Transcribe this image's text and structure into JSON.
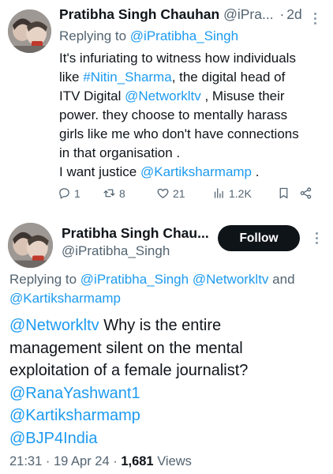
{
  "tweet1": {
    "author_name": "Pratibha Singh Chauhan",
    "author_handle_truncated": "@iPra...",
    "separator": "·",
    "time_ago": "2d",
    "replying_to_prefix": "Replying to",
    "replying_to_handle": "@iPratibha_Singh",
    "body": {
      "l1": "It's infuriating to witness how individuals",
      "l2_pre": "like ",
      "l2_tag": "#Nitin_Sharma",
      "l2_post": ", the digital head of",
      "l3_pre": "ITV Digital ",
      "l3_mention": "@Networkltv",
      "l3_post": " , Misuse their",
      "l4": "power. they choose to mentally harass",
      "l5": "girls like me who don't have connections",
      "l6": "in that organisation .",
      "l7_pre": "I want justice ",
      "l7_mention": "@Kartiksharmamp",
      "l7_post": " ."
    },
    "actions": {
      "replies": "1",
      "reposts": "8",
      "likes": "21",
      "views": "1.2K"
    }
  },
  "tweet2": {
    "author_name": "Pratibha Singh Chau...",
    "author_handle": "@iPratibha_Singh",
    "follow_label": "Follow",
    "replying_to_prefix": "Replying to",
    "replying_to_1": "@iPratibha_Singh",
    "replying_to_2": "@Networkltv",
    "replying_to_and": "and",
    "replying_to_3": "@Kartiksharmamp",
    "body": {
      "l1_mention": "@Networkltv",
      "l1_post": " Why is the entire",
      "l2": "management silent on the mental",
      "l3": "exploitation of a female journalist?",
      "l4": "@RanaYashwant1",
      "l5": "@Kartiksharmamp",
      "l6": "@BJP4India"
    },
    "meta": {
      "time": "21:31",
      "date": "19 Apr 24",
      "views_count": "1,681",
      "views_label": "Views",
      "sep": "·"
    }
  },
  "colors": {
    "link": "#1d9bf0",
    "muted": "#536471",
    "text": "#0f1419",
    "follow_bg": "#0f1419"
  }
}
